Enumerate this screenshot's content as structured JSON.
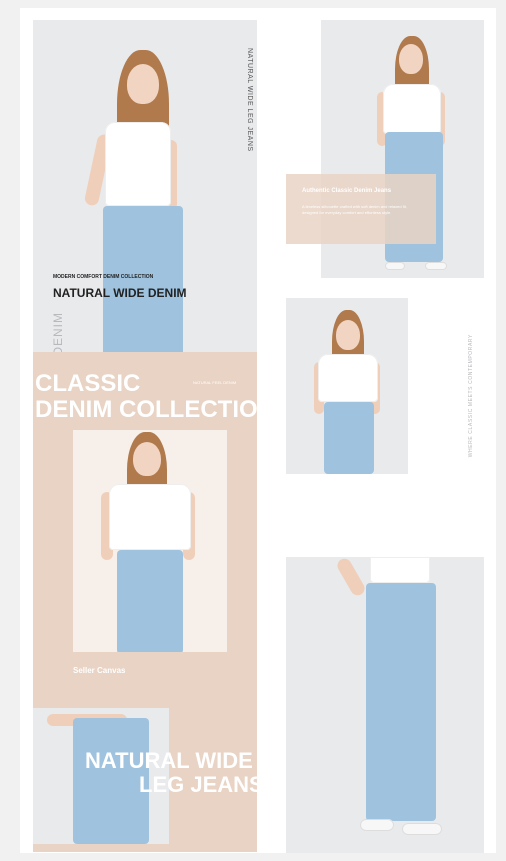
{
  "left_column": {
    "hero": {
      "side_label": "NATURAL WIDE LEG JEANS",
      "kicker": "MODERN COMFORT DENIM COLLECTION",
      "headline": "NATURAL WIDE DENIM",
      "vertical_word": "DENIM"
    },
    "classic": {
      "line1": "CLASSIC",
      "line2": "DENIM COLLECTION",
      "small_tag": "NATURAL FEEL DENIM",
      "caption": "Seller Canvas"
    },
    "bottom": {
      "line1": "NATURAL WIDE",
      "line2": "LEG JEANS"
    }
  },
  "right_column": {
    "top_card": {
      "title": "Authentic Classic Denim Jeans",
      "body": "A timeless silhouette crafted with soft denim and relaxed fit, designed for everyday comfort and effortless style."
    },
    "side_vertical": "WHERE CLASSIC MEETS CONTEMPORARY"
  },
  "colors": {
    "beige": "#e8d3c4",
    "denim": "#9fc3df",
    "hair": "#b07a4c"
  }
}
